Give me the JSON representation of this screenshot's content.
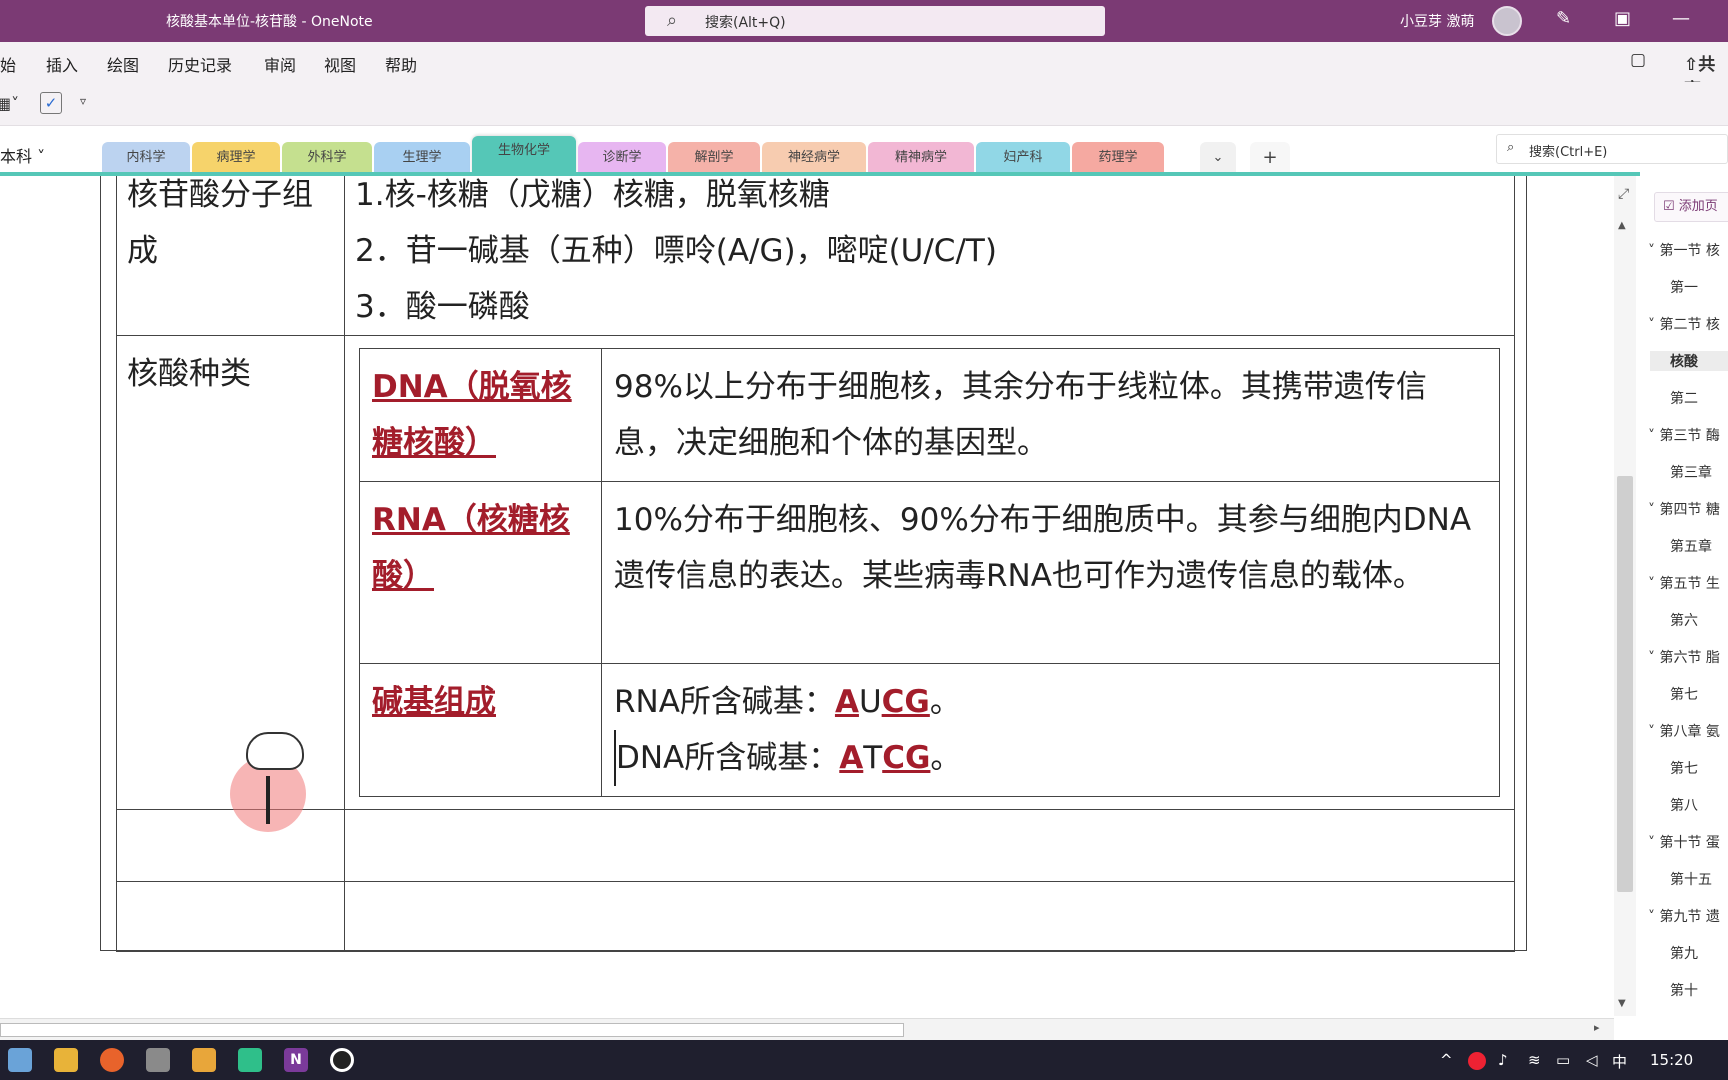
{
  "title_bar": {
    "title": "核酸基本单位-核苷酸  -  OneNote",
    "search_placeholder": "搜索(Alt+Q)",
    "user_name": "小豆芽 激萌"
  },
  "menu": {
    "items": [
      "开始",
      "插入",
      "绘图",
      "历史记录",
      "审阅",
      "视图",
      "帮助"
    ],
    "share_label": "共享"
  },
  "notebook_name": "本科",
  "section_tabs": [
    {
      "label": "内科学",
      "color": "#bcd3f0"
    },
    {
      "label": "病理学",
      "color": "#f6d36b"
    },
    {
      "label": "外科学",
      "color": "#c5e08f"
    },
    {
      "label": "生理学",
      "color": "#a9d0f2"
    },
    {
      "label": "生物化学",
      "color": "#55c7b7",
      "active": true
    },
    {
      "label": "诊断学",
      "color": "#e7b6f1"
    },
    {
      "label": "解剖学",
      "color": "#f5b2a9"
    },
    {
      "label": "神经病学",
      "color": "#f7ccb0"
    },
    {
      "label": "精神病学",
      "color": "#f2b7d4"
    },
    {
      "label": "妇产科",
      "color": "#91d7e6"
    },
    {
      "label": "药理学",
      "color": "#f5a9a1"
    }
  ],
  "page_search_placeholder": "搜索(Ctrl+E)",
  "add_page_label": "添加页",
  "note_table": {
    "row1_label": "核苷酸分子组成",
    "row1_lines": [
      "1.核-核糖（戊糖）核糖，脱氧核糖",
      "2．苷一碱基（五种）嘌呤(A/G)，嘧啶(U/C/T)",
      "3．酸一磷酸"
    ],
    "row2_label": "核酸种类",
    "dna_title": "DNA（脱氧核糖核酸）",
    "dna_desc": "98%以上分布于细胞核，其余分布于线粒体。其携带遗传信息，决定细胞和个体的基因型。",
    "rna_title": "RNA（核糖核酸）",
    "rna_desc": "10%分布于细胞核、90%分布于细胞质中。其参与细胞内DNA遗传信息的表达。某些病毒RNA也可作为遗传信息的载体。",
    "base_title": "碱基组成",
    "rna_base": {
      "prefix": "RNA所含碱基：",
      "a": "A",
      "u": "U",
      "cg": "CG",
      "end": "。"
    },
    "dna_base": {
      "prefix": "DNA所含碱基：",
      "a": "A",
      "t": "T",
      "cg": "CG",
      "end": "。"
    }
  },
  "page_list": [
    {
      "label": "第一节 核",
      "level": 1
    },
    {
      "label": "第一",
      "level": 2
    },
    {
      "label": "第二节 核",
      "level": 1
    },
    {
      "label": "核酸",
      "level": 2,
      "selected": true
    },
    {
      "label": "第二",
      "level": 2
    },
    {
      "label": "第三节 酶",
      "level": 1
    },
    {
      "label": "第三章",
      "level": 2
    },
    {
      "label": "第四节 糖",
      "level": 1
    },
    {
      "label": "第五章",
      "level": 2
    },
    {
      "label": "第五节 生",
      "level": 1
    },
    {
      "label": "第六",
      "level": 2
    },
    {
      "label": "第六节 脂",
      "level": 1
    },
    {
      "label": "第七",
      "level": 2
    },
    {
      "label": "第八章 氨",
      "level": 1
    },
    {
      "label": "第七",
      "level": 2
    },
    {
      "label": "第八",
      "level": 2
    },
    {
      "label": "第十节 蛋",
      "level": 1
    },
    {
      "label": "第十五",
      "level": 2
    },
    {
      "label": "第九节 遗",
      "level": 1
    },
    {
      "label": "第九",
      "level": 2
    },
    {
      "label": "第十",
      "level": 2
    }
  ],
  "taskbar": {
    "ime": "中",
    "time": "15:20"
  }
}
